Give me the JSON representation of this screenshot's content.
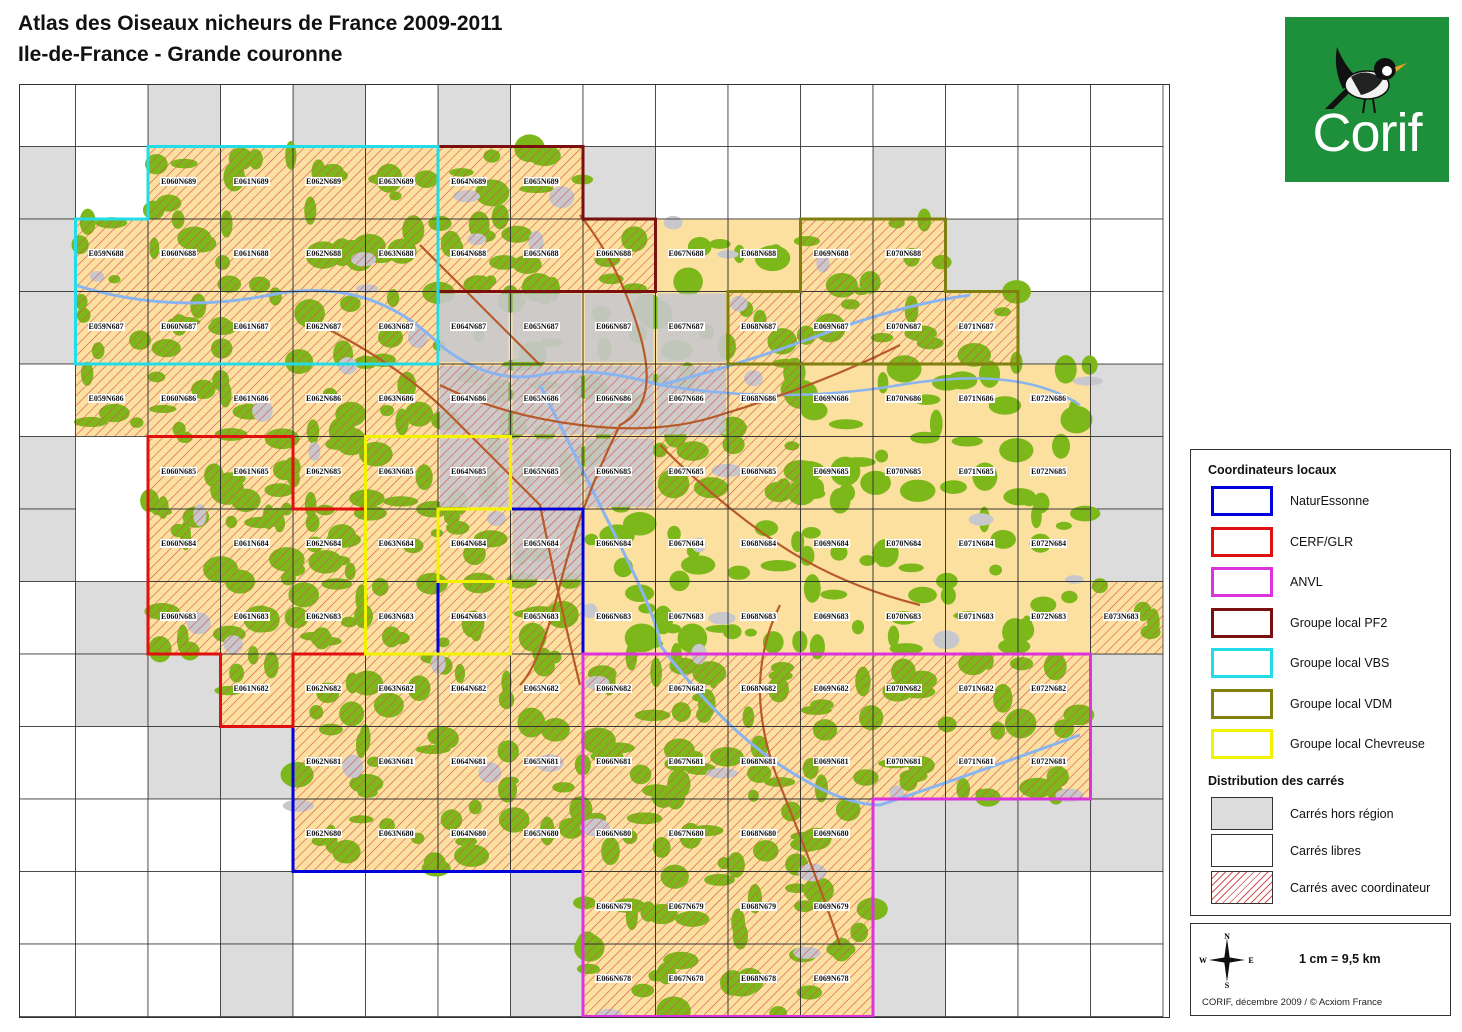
{
  "header": {
    "title": "Atlas des Oiseaux nicheurs de France 2009-2011",
    "subtitle": "Ile-de-France - Grande couronne"
  },
  "logo": {
    "text": "Corif",
    "icon": "bird-icon"
  },
  "legend": {
    "section_coordinators": "Coordinateurs locaux",
    "coordinators": [
      {
        "label": "NaturEssonne",
        "color": "#0000dd"
      },
      {
        "label": "CERF/GLR",
        "color": "#e01010"
      },
      {
        "label": "ANVL",
        "color": "#dd33dd"
      },
      {
        "label": "Groupe local PF2",
        "color": "#7a1010"
      },
      {
        "label": "Groupe local VBS",
        "color": "#22dde8"
      },
      {
        "label": "Groupe local VDM",
        "color": "#808010"
      },
      {
        "label": "Groupe local Chevreuse",
        "color": "#f2f200"
      }
    ],
    "section_distribution": "Distribution des carrés",
    "distribution": [
      {
        "label": "Carrés hors région",
        "fill": "#dcdcdc"
      },
      {
        "label": "Carrés libres",
        "fill": "#ffffff"
      },
      {
        "label": "Carrés avec coordinateur",
        "fill": "hatch"
      }
    ]
  },
  "scale": {
    "compass": {
      "n": "N",
      "s": "S",
      "e": "E",
      "w": "W"
    },
    "text": "1 cm = 9,5 km",
    "credit": "CORIF, décembre 2009 / © Acxiom France"
  },
  "map": {
    "colors": {
      "grey": "#dcdcdc",
      "hatch": "#d95050",
      "land": "#fbe0a0",
      "forest": "#7db81a",
      "urban": "#c8c8cc",
      "road": "#b85a28",
      "water": "#8ab4f0"
    },
    "grey_squares": [
      "E060N690",
      "E062N690",
      "E064N690",
      "E058N689",
      "E066N689",
      "E070N689",
      "E058N688",
      "E071N688",
      "E058N687",
      "E072N687",
      "E073N686",
      "E058N685",
      "E073N685",
      "E058N684",
      "E073N684",
      "E059N683",
      "E059N682",
      "E060N682",
      "E073N682",
      "E060N681",
      "E061N681",
      "E073N681",
      "E069N680",
      "E070N680",
      "E071N680",
      "E072N680",
      "E073N680",
      "E061N679",
      "E065N679",
      "E070N679",
      "E071N679",
      "E061N678",
      "E065N678",
      "E070N678"
    ],
    "white_squares": [
      "E058N690",
      "E059N690",
      "E061N690",
      "E063N690",
      "E065N690",
      "E066N690",
      "E067N690",
      "E068N690",
      "E069N690",
      "E070N690",
      "E071N690",
      "E072N690",
      "E073N690",
      "E059N689",
      "E067N689",
      "E068N689",
      "E069N689",
      "E071N689",
      "E072N689",
      "E073N689",
      "E072N688",
      "E073N688",
      "E073N687",
      "E058N686",
      "E058N683",
      "E058N682",
      "E058N681",
      "E059N681",
      "E058N680",
      "E059N680",
      "E060N680",
      "E061N680",
      "E058N679",
      "E059N679",
      "E060N679",
      "E062N679",
      "E063N679",
      "E064N679",
      "E072N679",
      "E073N679",
      "E058N678",
      "E059N678",
      "E060N678",
      "E062N678",
      "E063N678",
      "E064N678",
      "E071N678",
      "E072N678",
      "E073N678"
    ],
    "labeled_squares": [
      "E060N689",
      "E061N689",
      "E062N689",
      "E063N689",
      "E064N689",
      "E065N689",
      "E059N688",
      "E060N688",
      "E061N688",
      "E062N688",
      "E063N688",
      "E064N688",
      "E065N688",
      "E066N688",
      "E067N688",
      "E068N688",
      "E069N688",
      "E070N688",
      "E059N687",
      "E060N687",
      "E061N687",
      "E062N687",
      "E063N687",
      "E064N687",
      "E065N687",
      "E066N687",
      "E067N687",
      "E068N687",
      "E069N687",
      "E070N687",
      "E071N687",
      "E059N686",
      "E060N686",
      "E061N686",
      "E062N686",
      "E063N686",
      "E064N686",
      "E065N686",
      "E066N686",
      "E067N686",
      "E068N686",
      "E069N686",
      "E070N686",
      "E071N686",
      "E072N686",
      "E060N685",
      "E061N685",
      "E062N685",
      "E063N685",
      "E064N685",
      "E065N685",
      "E066N685",
      "E067N685",
      "E068N685",
      "E069N685",
      "E070N685",
      "E071N685",
      "E072N685",
      "E060N684",
      "E061N684",
      "E062N684",
      "E063N684",
      "E064N684",
      "E065N684",
      "E066N684",
      "E067N684",
      "E068N684",
      "E069N684",
      "E070N684",
      "E071N684",
      "E072N684",
      "E060N683",
      "E061N683",
      "E062N683",
      "E063N683",
      "E064N683",
      "E065N683",
      "E066N683",
      "E067N683",
      "E068N683",
      "E069N683",
      "E070N683",
      "E071N683",
      "E072N683",
      "E073N683",
      "E061N682",
      "E062N682",
      "E063N682",
      "E064N682",
      "E065N682",
      "E066N682",
      "E067N682",
      "E068N682",
      "E069N682",
      "E070N682",
      "E071N682",
      "E072N682",
      "E062N681",
      "E063N681",
      "E064N681",
      "E065N681",
      "E066N681",
      "E067N681",
      "E068N681",
      "E069N681",
      "E070N681",
      "E071N681",
      "E072N681",
      "E062N680",
      "E063N680",
      "E064N680",
      "E065N680",
      "E066N680",
      "E067N680",
      "E068N680",
      "E069N680",
      "E066N679",
      "E067N679",
      "E068N679",
      "E069N679",
      "E066N678",
      "E067N678",
      "E068N678",
      "E069N678"
    ],
    "hatched_squares": [
      "E060N689",
      "E061N689",
      "E062N689",
      "E063N689",
      "E064N689",
      "E065N689",
      "E059N688",
      "E060N688",
      "E061N688",
      "E062N688",
      "E063N688",
      "E064N688",
      "E065N688",
      "E066N688",
      "E069N688",
      "E070N688",
      "E059N687",
      "E060N687",
      "E061N687",
      "E062N687",
      "E063N687",
      "E068N687",
      "E069N687",
      "E070N687",
      "E071N687",
      "E059N686",
      "E060N686",
      "E061N686",
      "E062N686",
      "E063N686",
      "E064N686",
      "E065N686",
      "E066N686",
      "E067N686",
      "E068N686",
      "E060N685",
      "E061N685",
      "E062N685",
      "E063N685",
      "E064N685",
      "E065N685",
      "E066N685",
      "E067N685",
      "E068N685",
      "E060N684",
      "E061N684",
      "E062N684",
      "E063N684",
      "E064N684",
      "E065N684",
      "E060N683",
      "E061N683",
      "E062N683",
      "E063N683",
      "E064N683",
      "E065N683",
      "E073N683",
      "E061N682",
      "E062N682",
      "E063N682",
      "E064N682",
      "E065N682",
      "E066N682",
      "E067N682",
      "E068N682",
      "E069N682",
      "E070N682",
      "E071N682",
      "E072N682",
      "E062N681",
      "E063N681",
      "E064N681",
      "E065N681",
      "E066N681",
      "E067N681",
      "E068N681",
      "E069N681",
      "E070N681",
      "E071N681",
      "E072N681",
      "E062N680",
      "E063N680",
      "E064N680",
      "E065N680",
      "E066N680",
      "E067N680",
      "E068N680",
      "E069N680",
      "E066N679",
      "E067N679",
      "E068N679",
      "E069N679",
      "E066N678",
      "E067N678",
      "E068N678",
      "E069N678"
    ],
    "groups": [
      {
        "name": "NaturEssonne",
        "color": "#0000dd",
        "squares": [
          "E064N684",
          "E065N684",
          "E064N683",
          "E065N683",
          "E062N682",
          "E063N682",
          "E064N682",
          "E065N682",
          "E062N681",
          "E063N681",
          "E064N681",
          "E065N681",
          "E062N680",
          "E063N680",
          "E064N680",
          "E065N680"
        ]
      },
      {
        "name": "CERF/GLR",
        "color": "#e01010",
        "squares": [
          "E060N685",
          "E061N685",
          "E060N684",
          "E061N684",
          "E062N684",
          "E060N683",
          "E061N683",
          "E062N683",
          "E061N682"
        ]
      },
      {
        "name": "ANVL",
        "color": "#dd33dd",
        "squares": [
          "E066N682",
          "E067N682",
          "E068N682",
          "E069N682",
          "E070N682",
          "E071N682",
          "E072N682",
          "E066N681",
          "E067N681",
          "E068N681",
          "E069N681",
          "E070N681",
          "E071N681",
          "E072N681",
          "E066N680",
          "E067N680",
          "E068N680",
          "E069N680",
          "E066N679",
          "E067N679",
          "E068N679",
          "E069N679",
          "E066N678",
          "E067N678",
          "E068N678",
          "E069N678"
        ]
      },
      {
        "name": "Groupe local PF2",
        "color": "#7a1010",
        "squares": [
          "E064N689",
          "E065N689",
          "E064N688",
          "E065N688",
          "E066N688"
        ]
      },
      {
        "name": "Groupe local VBS",
        "color": "#22dde8",
        "squares": [
          "E060N689",
          "E061N689",
          "E062N689",
          "E063N689",
          "E059N688",
          "E060N688",
          "E061N688",
          "E062N688",
          "E063N688",
          "E059N687",
          "E060N687",
          "E061N687",
          "E062N687",
          "E063N687"
        ]
      },
      {
        "name": "Groupe local VDM",
        "color": "#808010",
        "squares": [
          "E069N688",
          "E070N688",
          "E068N687",
          "E069N687",
          "E070N687",
          "E071N687"
        ]
      },
      {
        "name": "Groupe local Chevreuse",
        "color": "#f2f200",
        "squares": [
          "E063N685",
          "E064N685",
          "E063N684",
          "E063N683",
          "E064N683"
        ]
      }
    ]
  }
}
